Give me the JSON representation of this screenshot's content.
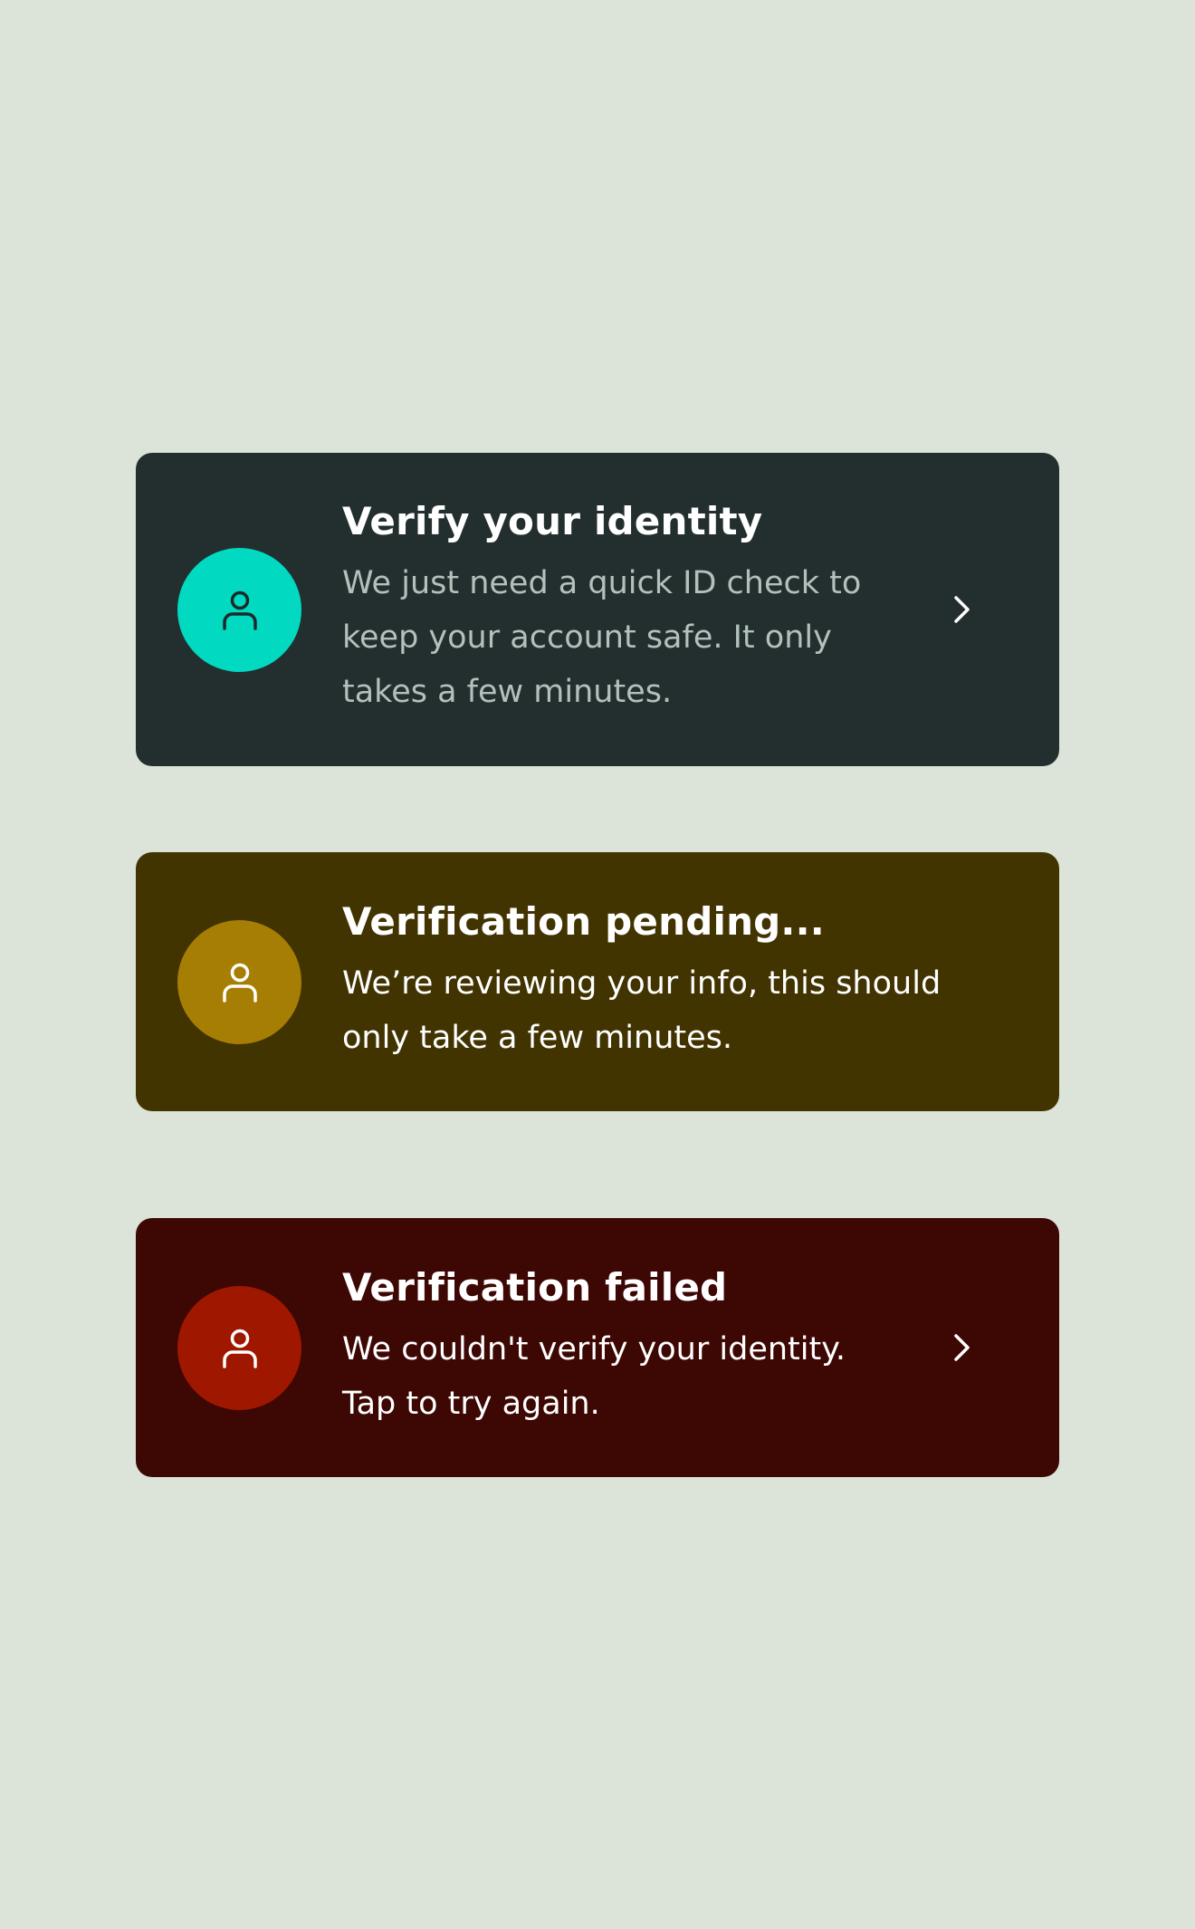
{
  "colors": {
    "background": "#dce3d9",
    "verify_card": "#232f2f",
    "verify_accent": "#01d9c1",
    "pending_card": "#423401",
    "pending_accent": "#a77e04",
    "failed_card": "#3d0703",
    "failed_accent": "#a01700"
  },
  "cards": {
    "verify": {
      "icon": "user-icon",
      "title": "Verify your identity",
      "description": "We just need a quick ID check to keep your account safe. It only takes a few minutes.",
      "action_icon": "chevron-right-icon"
    },
    "pending": {
      "icon": "user-icon",
      "title": "Verification pending...",
      "description": "We’re reviewing your info, this should only take a few minutes."
    },
    "failed": {
      "icon": "user-icon",
      "title": "Verification failed",
      "description": "We couldn't verify your identity. Tap to try again.",
      "action_icon": "chevron-right-icon"
    }
  }
}
